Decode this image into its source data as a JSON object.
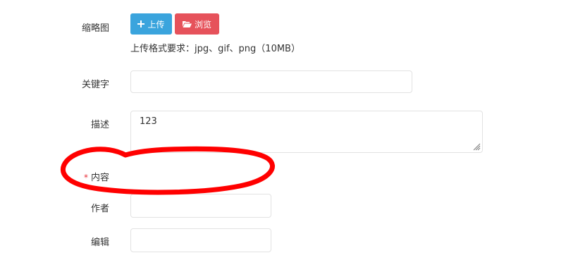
{
  "form": {
    "thumbnail": {
      "label": "缩略图",
      "upload_label": "上传",
      "browse_label": "浏览",
      "hint": "上传格式要求：jpg、gif、png（10MB）"
    },
    "keywords": {
      "label": "关键字",
      "value": ""
    },
    "description": {
      "label": "描述",
      "value": "123"
    },
    "content": {
      "label": "内容",
      "required_mark": "*"
    },
    "author": {
      "label": "作者",
      "value": ""
    },
    "editor": {
      "label": "编辑",
      "value": ""
    }
  },
  "icons": {
    "upload": "plus-icon",
    "browse": "folder-open-icon",
    "resize": "resize-grip-icon"
  },
  "colors": {
    "upload_button": "#3aa4dd",
    "browse_button": "#e6525b",
    "required_star": "#e8303a",
    "annotation_circle": "#ff0000"
  }
}
